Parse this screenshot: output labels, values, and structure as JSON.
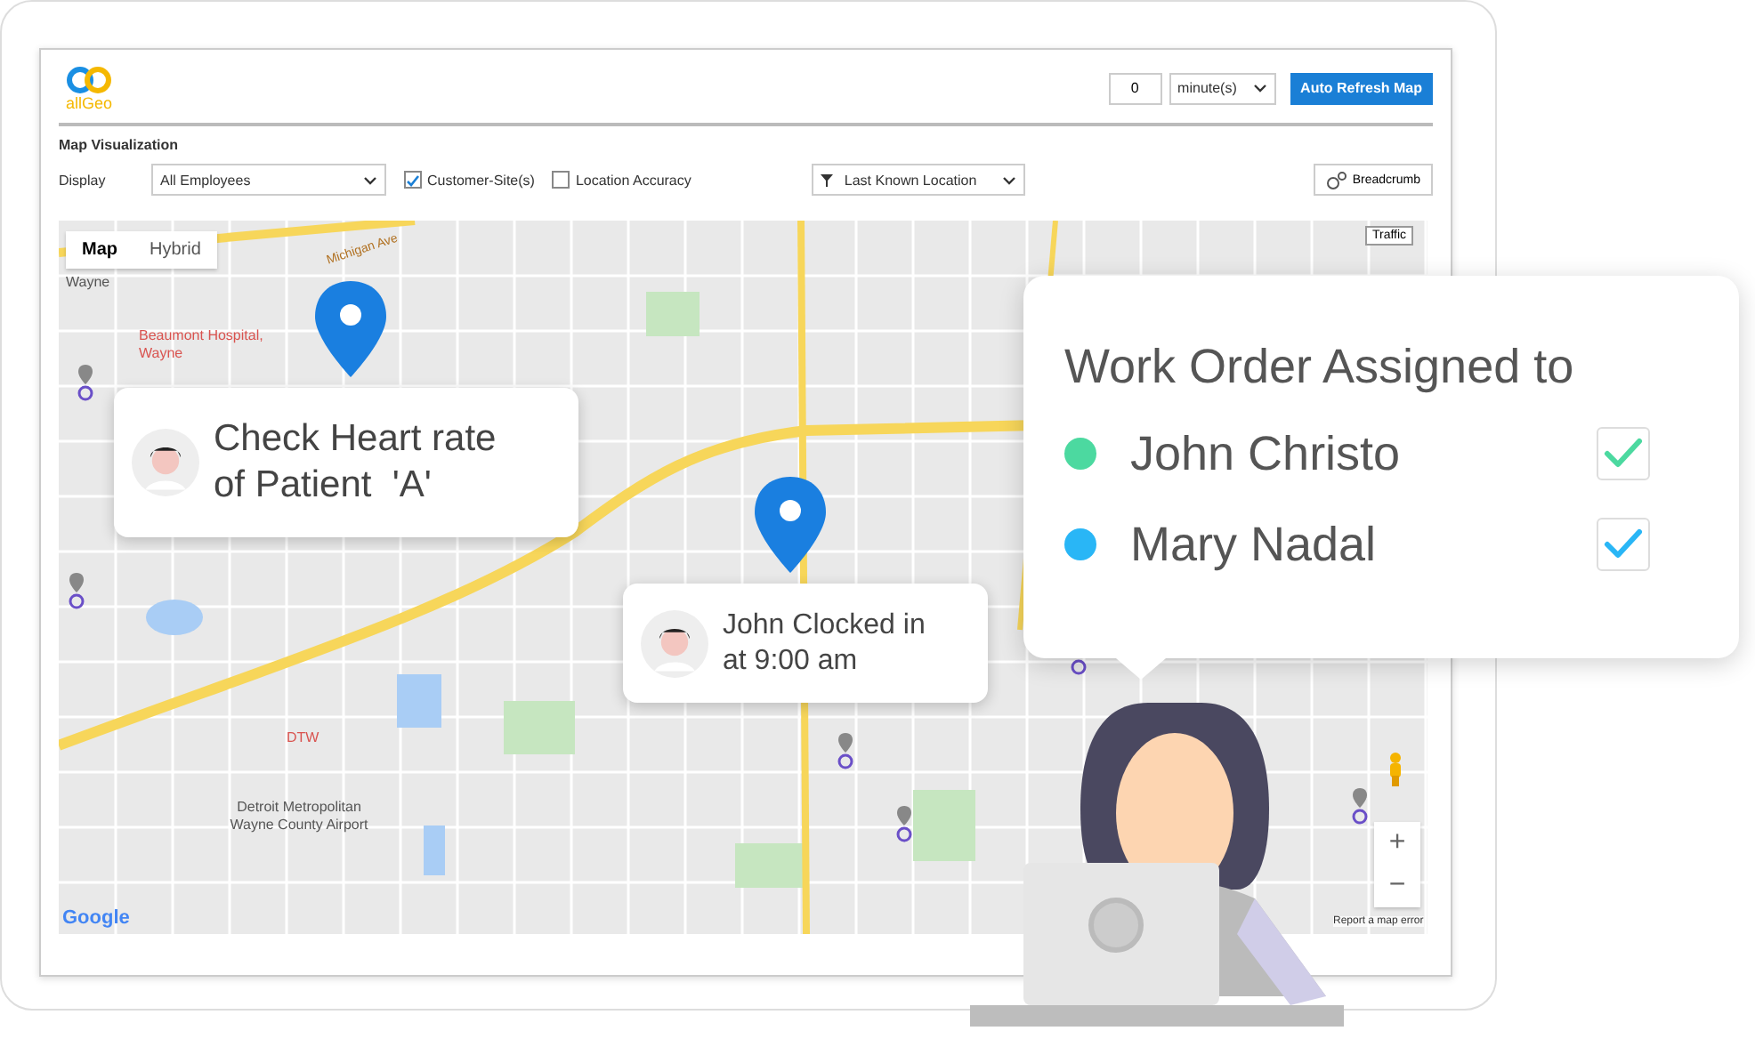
{
  "app": {
    "logo_text": "allGeo",
    "refresh_interval": "0",
    "interval_unit": "minute(s)",
    "refresh_button": "Auto Refresh Map"
  },
  "section_title": "Map Visualization",
  "filters": {
    "display_label": "Display",
    "display_value": "All Employees",
    "location_filter": "Last Known Location",
    "breadcrumb_button": "Breadcrumb",
    "options": [
      {
        "label": "Customer-Site(s)",
        "checked": true
      },
      {
        "label": "Location Accuracy",
        "checked": false
      }
    ]
  },
  "map": {
    "tabs": [
      {
        "label": "Map",
        "selected": true
      },
      {
        "label": "Hybrid",
        "selected": false
      }
    ],
    "traffic_button": "Traffic",
    "labels": [
      {
        "text": "Michigan Ave",
        "kind": "road"
      },
      {
        "text": "Wayne",
        "kind": "place"
      },
      {
        "text": "Beaumont Hospital, Wayne",
        "kind": "poi"
      },
      {
        "text": "DTW",
        "kind": "poi"
      },
      {
        "text": "Detroit Metropolitan Wayne County Airport",
        "kind": "place"
      }
    ],
    "zoom_in": "+",
    "zoom_out": "−",
    "attribution": "Google",
    "report_link": "Report a map error"
  },
  "callouts": [
    {
      "text": "Check Heart rate of Patient  'A'"
    },
    {
      "text": "John Clocked in at 9:00 am"
    }
  ],
  "work_order": {
    "title": "Work Order Assigned to",
    "assignees": [
      {
        "name": "John Christo",
        "color": "#4cd9a0",
        "checked": true
      },
      {
        "name": "Mary Nadal",
        "color": "#29b6f6",
        "checked": true
      }
    ]
  }
}
